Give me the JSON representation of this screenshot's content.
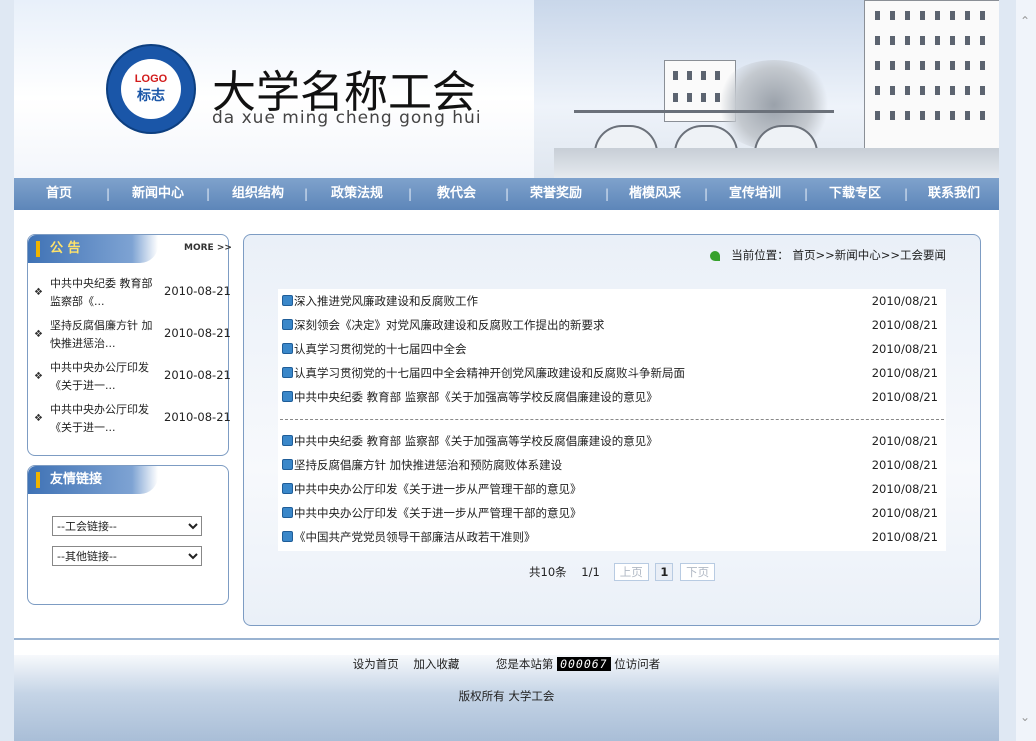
{
  "header": {
    "logo_top": "LOGO",
    "logo_bottom": "标志",
    "site_title": "大学名称工会",
    "site_subtitle": "da xue ming cheng gong hui"
  },
  "nav": {
    "items": [
      "首页",
      "新闻中心",
      "组织结构",
      "政策法规",
      "教代会",
      "荣誉奖励",
      "楷模风采",
      "宣传培训",
      "下载专区",
      "联系我们"
    ],
    "separator": "|"
  },
  "announce": {
    "title": "公 告",
    "more": "MORE >>",
    "items": [
      {
        "text": "中共中央纪委 教育部 监察部《...",
        "date": "2010-08-21"
      },
      {
        "text": "坚持反腐倡廉方针 加快推进惩治...",
        "date": "2010-08-21"
      },
      {
        "text": "中共中央办公厅印发《关于进一...",
        "date": "2010-08-21"
      },
      {
        "text": "中共中央办公厅印发《关于进一...",
        "date": "2010-08-21"
      }
    ],
    "bullet": "❖"
  },
  "links": {
    "title": "友情链接",
    "union_select": "--工会链接--",
    "other_select": "--其他链接--"
  },
  "breadcrumb": {
    "label": "当前位置：",
    "path": "首页>>新闻中心>>工会要闻"
  },
  "news": {
    "group1": [
      {
        "title": "深入推进党风廉政建设和反腐败工作",
        "date": "2010/08/21"
      },
      {
        "title": "深刻领会《决定》对党风廉政建设和反腐败工作提出的新要求",
        "date": "2010/08/21"
      },
      {
        "title": "认真学习贯彻党的十七届四中全会",
        "date": "2010/08/21"
      },
      {
        "title": "认真学习贯彻党的十七届四中全会精神开创党风廉政建设和反腐败斗争新局面",
        "date": "2010/08/21"
      },
      {
        "title": "中共中央纪委 教育部 监察部《关于加强高等学校反腐倡廉建设的意见》",
        "date": "2010/08/21"
      }
    ],
    "group2": [
      {
        "title": "中共中央纪委 教育部 监察部《关于加强高等学校反腐倡廉建设的意见》",
        "date": "2010/08/21"
      },
      {
        "title": "坚持反腐倡廉方针 加快推进惩治和预防腐败体系建设",
        "date": "2010/08/21"
      },
      {
        "title": "中共中央办公厅印发《关于进一步从严管理干部的意见》",
        "date": "2010/08/21"
      },
      {
        "title": "中共中央办公厅印发《关于进一步从严管理干部的意见》",
        "date": "2010/08/21"
      },
      {
        "title": "《中国共产党党员领导干部廉洁从政若干准则》",
        "date": "2010/08/21"
      }
    ]
  },
  "pager": {
    "total": "共10条",
    "page_info": "1/1",
    "prev": "上页",
    "current": "1",
    "next": "下页"
  },
  "footer": {
    "set_home": "设为首页",
    "add_fav": "加入收藏",
    "visitor_prefix": "您是本站第",
    "visitor_count": "000067",
    "visitor_suffix": "位访问者",
    "copyright": "版权所有 大学工会"
  }
}
